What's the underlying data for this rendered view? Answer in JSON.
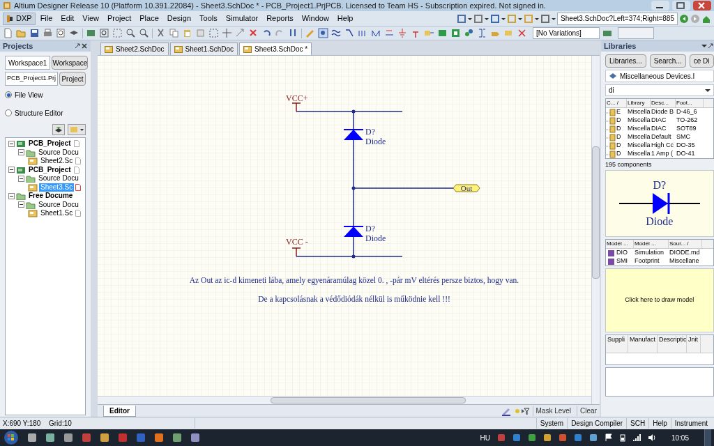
{
  "window": {
    "title": "Altium Designer Release 10 (Platform 10.391.22084) - Sheet3.SchDoc * - PCB_Project1.PrjPCB. Licensed to Team HS - Subscription expired. Not signed in."
  },
  "menu": {
    "dxp": "DXP",
    "items": [
      "File",
      "Edit",
      "View",
      "Project",
      "Place",
      "Design",
      "Tools",
      "Simulator",
      "Reports",
      "Window",
      "Help"
    ]
  },
  "toolbar": {
    "view_field": "Sheet3.SchDoc?Left=374;Right=885",
    "variations": "[No Variations]"
  },
  "projects_panel": {
    "title": "Projects",
    "workspace_select": "Workspace1",
    "workspace_button": "Workspace",
    "project_field": "PCB_Project1.Prj",
    "project_button": "Project",
    "views": [
      {
        "label": "File View",
        "selected": true
      },
      {
        "label": "Structure Editor",
        "selected": false
      }
    ],
    "tree": [
      {
        "kind": "project",
        "label": "PCB_Project",
        "expanded": true,
        "selected": false,
        "children": [
          {
            "kind": "folder",
            "label": "Source Docu",
            "expanded": true,
            "selected": false,
            "children": [
              {
                "kind": "document",
                "label": "Sheet2.Sc",
                "selected": false
              }
            ]
          }
        ]
      },
      {
        "kind": "project",
        "label": "PCB_Project",
        "expanded": true,
        "selected": false,
        "children": [
          {
            "kind": "folder",
            "label": "Source Docu",
            "expanded": true,
            "selected": false,
            "children": [
              {
                "kind": "document",
                "label": "Sheet3.Sc",
                "selected": true
              }
            ]
          }
        ]
      },
      {
        "kind": "free",
        "label": "Free Docume",
        "expanded": true,
        "selected": false,
        "children": [
          {
            "kind": "folder",
            "label": "Source Docu",
            "expanded": true,
            "selected": false,
            "children": [
              {
                "kind": "document",
                "label": "Sheet1.Sc",
                "selected": false
              }
            ]
          }
        ]
      }
    ]
  },
  "document_tabs": [
    {
      "label": "Sheet2.SchDoc",
      "selected": false
    },
    {
      "label": "Sheet1.SchDoc",
      "selected": false
    },
    {
      "label": "Sheet3.SchDoc *",
      "selected": true
    }
  ],
  "schematic": {
    "power_ports": [
      "VCC+",
      "VCC -"
    ],
    "diodes": [
      {
        "designator": "D?",
        "comment": "Diode"
      },
      {
        "designator": "D?",
        "comment": "Diode"
      }
    ],
    "net_label": "Out",
    "notes": [
      "Az Out az ic-d kimeneti lába, amely egyenáramúlag közel 0. , -pár mV eltérés persze biztos, hogy van.",
      "De a kapcsolásnak a védődiódák nélkül is működnie kell !!!"
    ]
  },
  "editor_bar": {
    "tab": "Editor",
    "mask_level": "Mask Level",
    "clear": "Clear"
  },
  "libraries_panel": {
    "title": "Libraries",
    "buttons": [
      "Libraries...",
      "Search...",
      "ce Di"
    ],
    "library_select": "Miscellaneous Devices.I",
    "filter": "di",
    "columns": [
      "C... /",
      "Library",
      "Desc...",
      "Foot..."
    ],
    "rows": [
      [
        "E",
        "Miscella",
        "Diode B",
        "D-46_6"
      ],
      [
        "D",
        "Miscella",
        "DIAC",
        "TO-262"
      ],
      [
        "D",
        "Miscella",
        "DIAC",
        "SOT89"
      ],
      [
        "D",
        "Miscella",
        "Default",
        "SMC"
      ],
      [
        "D",
        "Miscella",
        "High Cc",
        "DO-35"
      ],
      [
        "D",
        "Miscella",
        "1 Amp (",
        "DO-41"
      ]
    ],
    "count": "195 components",
    "preview": {
      "designator": "D?",
      "comment": "Diode"
    },
    "model_columns": [
      "Model ...",
      "Model ...",
      "Sour... /"
    ],
    "model_rows": [
      [
        "DIO",
        "Simulation",
        "DIODE.md"
      ],
      [
        "SMI",
        "Footprint",
        "Miscellane"
      ]
    ],
    "model_preview": "Click here to draw model",
    "supplier_columns": [
      "Suppli",
      "Manufact",
      "Descriptic",
      "Jnit"
    ]
  },
  "status_bar": {
    "coordinates": "X:690 Y:180",
    "grid": "Grid:10",
    "panels": [
      "System",
      "Design Compiler",
      "SCH",
      "Help",
      "Instrument"
    ]
  },
  "taskbar": {
    "language": "HU",
    "time": "10:05"
  }
}
